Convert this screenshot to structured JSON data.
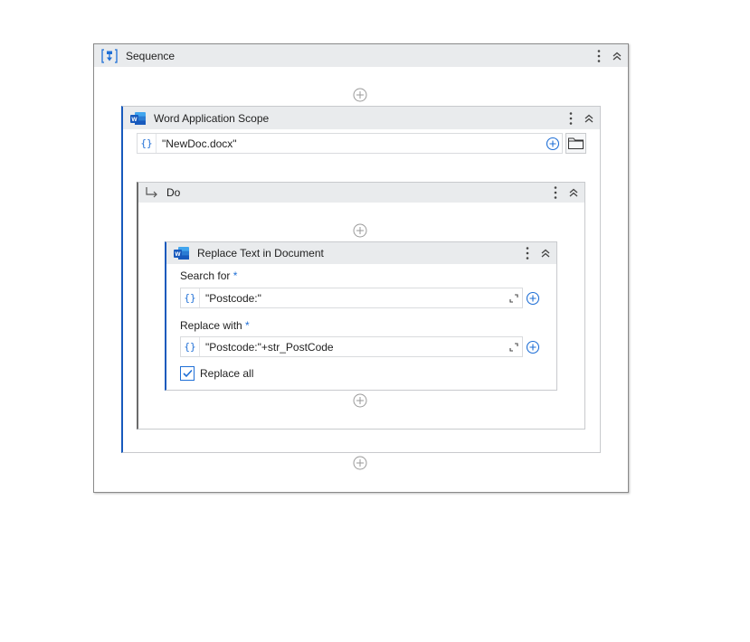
{
  "sequence": {
    "title": "Sequence",
    "icon": "sequence-icon"
  },
  "word_scope": {
    "title": "Word Application Scope",
    "file_path": "\"NewDoc.docx\"",
    "icon": "word-icon"
  },
  "do_block": {
    "title": "Do",
    "icon": "do-arrow-icon"
  },
  "replace_activity": {
    "title": "Replace Text in Document",
    "search_label": "Search for",
    "search_required": "*",
    "search_value": "\"Postcode:\"",
    "replace_label": "Replace with",
    "replace_required": "*",
    "replace_value": "\"Postcode:\"+str_PostCode",
    "replace_all_label": "Replace all",
    "replace_all_checked": true
  },
  "field_brace": "{}",
  "colors": {
    "accent": "#1f6fd6",
    "word_blue": "#185abd",
    "header_bg": "#e9ebed",
    "border": "#c8cacd"
  }
}
